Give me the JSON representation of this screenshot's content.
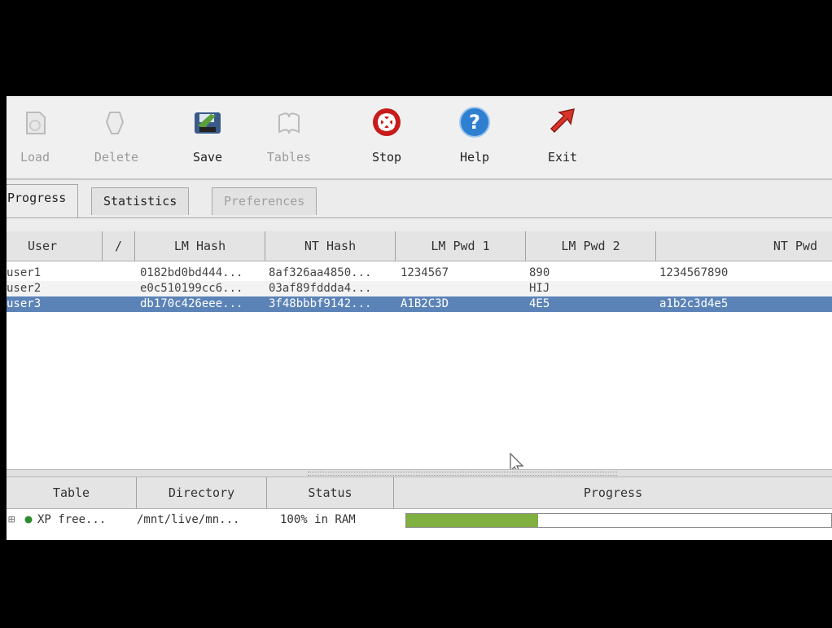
{
  "toolbar": {
    "buttons": [
      {
        "label": "Load",
        "icon": "load-icon",
        "enabled": false
      },
      {
        "label": "Delete",
        "icon": "delete-icon",
        "enabled": false
      },
      {
        "label": "Save",
        "icon": "save-icon",
        "enabled": true
      },
      {
        "label": "Tables",
        "icon": "tables-icon",
        "enabled": false
      },
      {
        "label": "Stop",
        "icon": "stop-icon",
        "enabled": true
      },
      {
        "label": "Help",
        "icon": "help-icon",
        "enabled": true
      },
      {
        "label": "Exit",
        "icon": "exit-icon",
        "enabled": true
      }
    ]
  },
  "tabs": [
    {
      "label": "Progress",
      "active": true
    },
    {
      "label": "Statistics",
      "active": false
    },
    {
      "label": "Preferences",
      "active": false,
      "disabled": true
    }
  ],
  "hash_table": {
    "columns": [
      "User",
      "/",
      "LM Hash",
      "NT Hash",
      "LM Pwd 1",
      "LM Pwd 2",
      "NT Pwd"
    ],
    "rows": [
      {
        "user": "user1",
        "lm_hash": "0182bd0bd444...",
        "nt_hash": "8af326aa4850...",
        "lm_pwd1": "1234567",
        "lm_pwd2": "890",
        "nt_pwd": "1234567890"
      },
      {
        "user": "user2",
        "lm_hash": "e0c510199cc6...",
        "nt_hash": "03af89fddda4...",
        "lm_pwd1": "",
        "lm_pwd2": "HIJ",
        "nt_pwd": ""
      },
      {
        "user": "user3",
        "lm_hash": "db170c426eee...",
        "nt_hash": "3f48bbbf9142...",
        "lm_pwd1": "A1B2C3D",
        "lm_pwd2": "4E5",
        "nt_pwd": "a1b2c3d4e5",
        "selected": true
      }
    ]
  },
  "tables_list": {
    "columns": [
      "Table",
      "Directory",
      "Status",
      "Progress"
    ],
    "rows": [
      {
        "expander": "⊞",
        "table": "XP free...",
        "directory": "/mnt/live/mn...",
        "status": "100% in RAM",
        "progress": 0.31,
        "status_color": "#2e8b2e"
      }
    ]
  },
  "colors": {
    "selection": "#5b83b7",
    "progress_fill": "#7fb040",
    "stop": "#c81c1c",
    "help": "#2f7fd0",
    "exit": "#d9342c"
  }
}
